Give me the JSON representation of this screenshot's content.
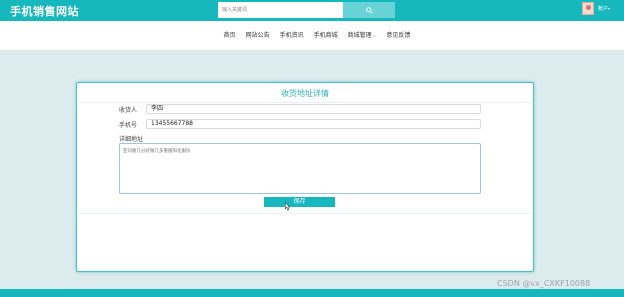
{
  "header": {
    "site_title": "手机销售网站",
    "search_placeholder": "输入关键词",
    "user_label": "账户",
    "user_arrow": "▾"
  },
  "nav": {
    "items": [
      "首页",
      "网站公告",
      "手机资讯",
      "手机商城",
      "商城管理",
      "意见反馈"
    ],
    "dropdown_caret": "⌵"
  },
  "form": {
    "title": "收货地址详情",
    "recipient_label": "收货人",
    "recipient_value": "李四",
    "phone_label": "手机号",
    "phone_value": "13455667788",
    "address_label": "详细地址",
    "address_value": "亚同路几分好做几多重搬阳化服份",
    "save_label": "保存"
  },
  "watermark": "CSDN @vx_CXKF10088",
  "colors": {
    "brand": "#16b8be",
    "page_bg": "#dcecee"
  }
}
